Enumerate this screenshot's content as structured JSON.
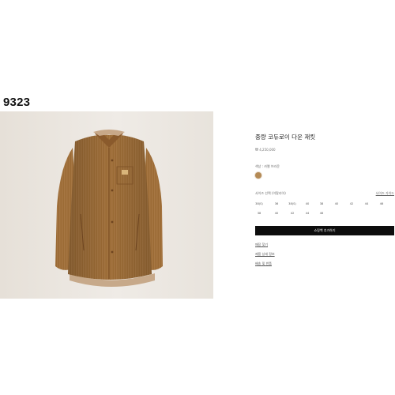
{
  "page_code": "9323",
  "product": {
    "image_alt": "corduroy down jacket",
    "title": "중량 코듀로이 다운 재킷",
    "price": "₩ 4,250,000",
    "color_label": "색상 : 카멜 브라운",
    "swatch_color": "#b48a55",
    "size_label": "사이즈 선택 (이탈리아)",
    "size_guide_label": "사이즈 가이드",
    "sizes_row1": [
      "38(S)",
      "36",
      "38(S)",
      "40",
      "38",
      "40",
      "42",
      "44",
      "46"
    ],
    "sizes_row2": [
      "38",
      "40",
      "42",
      "44",
      "46"
    ],
    "cta_label": "쇼핑백 추가하기",
    "links": [
      "매장 찾기",
      "제품 상세 정보",
      "배송 및 반품"
    ]
  }
}
